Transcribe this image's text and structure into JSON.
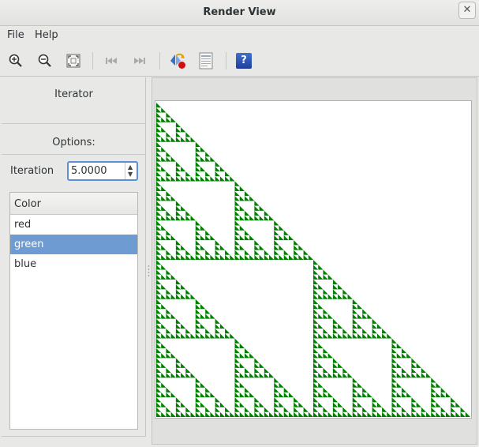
{
  "window": {
    "title": "Render View",
    "close_glyph": "✕"
  },
  "menu": {
    "items": [
      "File",
      "Help"
    ]
  },
  "toolbar": {
    "buttons": [
      {
        "name": "zoom-in-icon",
        "enabled": true
      },
      {
        "name": "zoom-out-icon",
        "enabled": true
      },
      {
        "name": "zoom-fit-icon",
        "enabled": true
      },
      {
        "name": "first-frame-icon",
        "enabled": false
      },
      {
        "name": "last-frame-icon",
        "enabled": false
      },
      {
        "name": "export-image-icon",
        "enabled": true
      },
      {
        "name": "document-view-icon",
        "enabled": true
      },
      {
        "name": "help-icon",
        "enabled": true
      }
    ],
    "help_glyph": "?"
  },
  "panel": {
    "section_title": "Iterator",
    "options_title": "Options:",
    "iteration_label": "Iteration",
    "iteration_value": "5.0000",
    "list": {
      "header": "Color",
      "items": [
        "red",
        "green",
        "blue"
      ],
      "selected_index": 1
    }
  },
  "render": {
    "fractal": "sierpinski-triangle",
    "iterations": 5,
    "fill_color": "#008000",
    "background_color": "#ffffff"
  }
}
